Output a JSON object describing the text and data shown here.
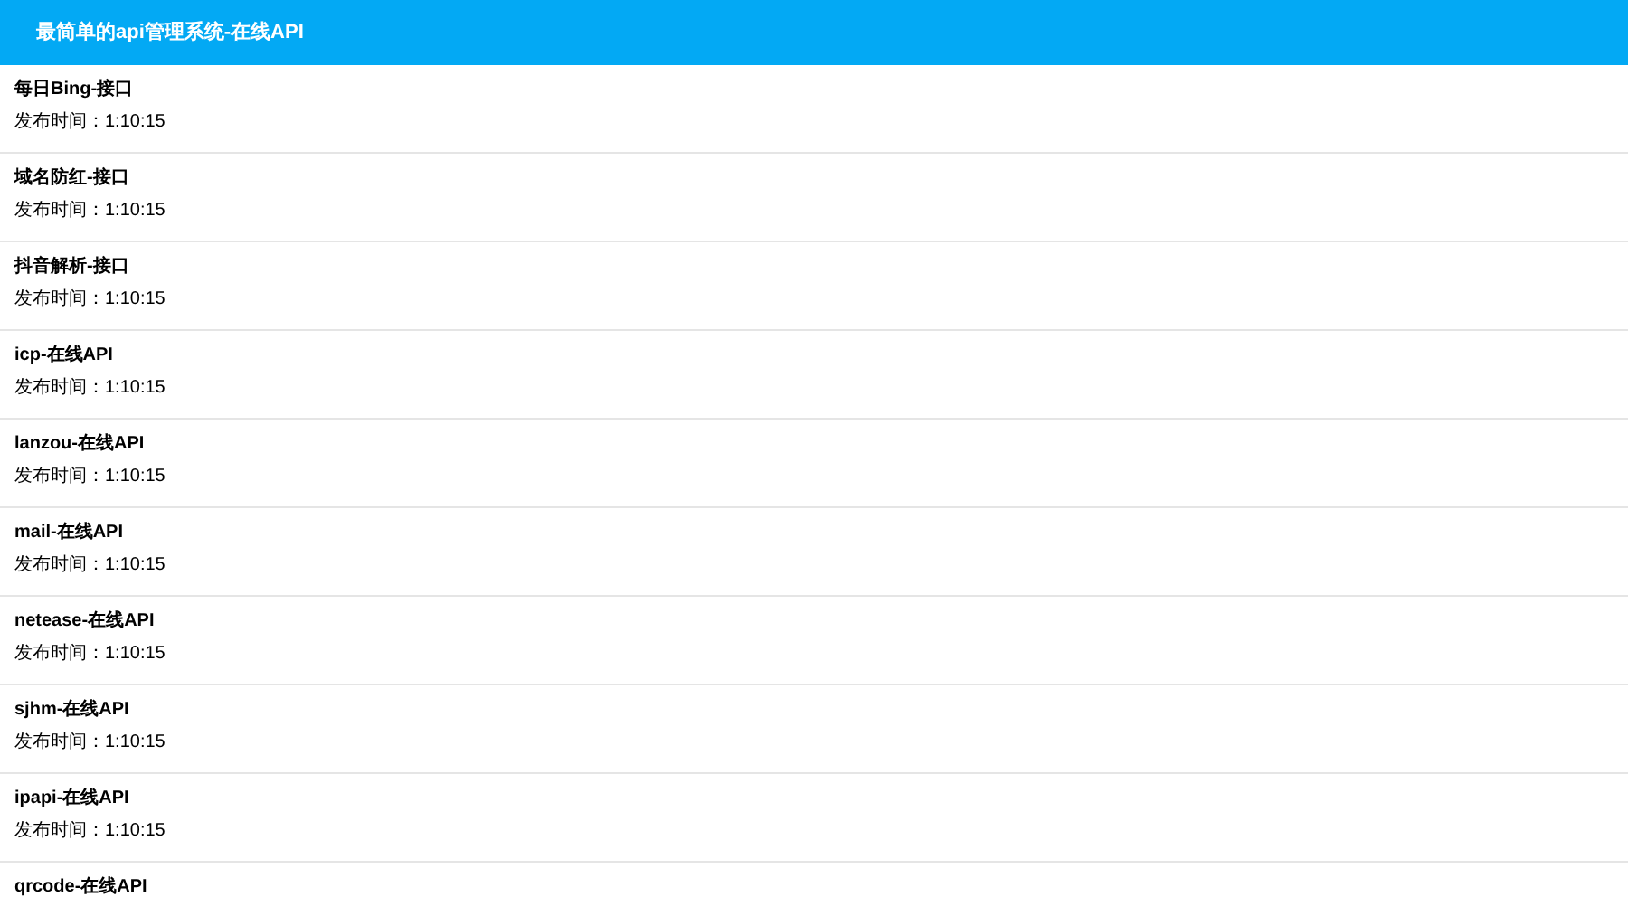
{
  "header": {
    "title": "最简单的api管理系统-在线API"
  },
  "items": [
    {
      "name": "每日Bing-接口",
      "time": "发布时间：1:10:15"
    },
    {
      "name": "域名防红-接口",
      "time": "发布时间：1:10:15"
    },
    {
      "name": "抖音解析-接口",
      "time": "发布时间：1:10:15"
    },
    {
      "name": "icp-在线API",
      "time": "发布时间：1:10:15"
    },
    {
      "name": "lanzou-在线API",
      "time": "发布时间：1:10:15"
    },
    {
      "name": "mail-在线API",
      "time": "发布时间：1:10:15"
    },
    {
      "name": "netease-在线API",
      "time": "发布时间：1:10:15"
    },
    {
      "name": "sjhm-在线API",
      "time": "发布时间：1:10:15"
    },
    {
      "name": "ipapi-在线API",
      "time": "发布时间：1:10:15"
    },
    {
      "name": "qrcode-在线API"
    }
  ]
}
